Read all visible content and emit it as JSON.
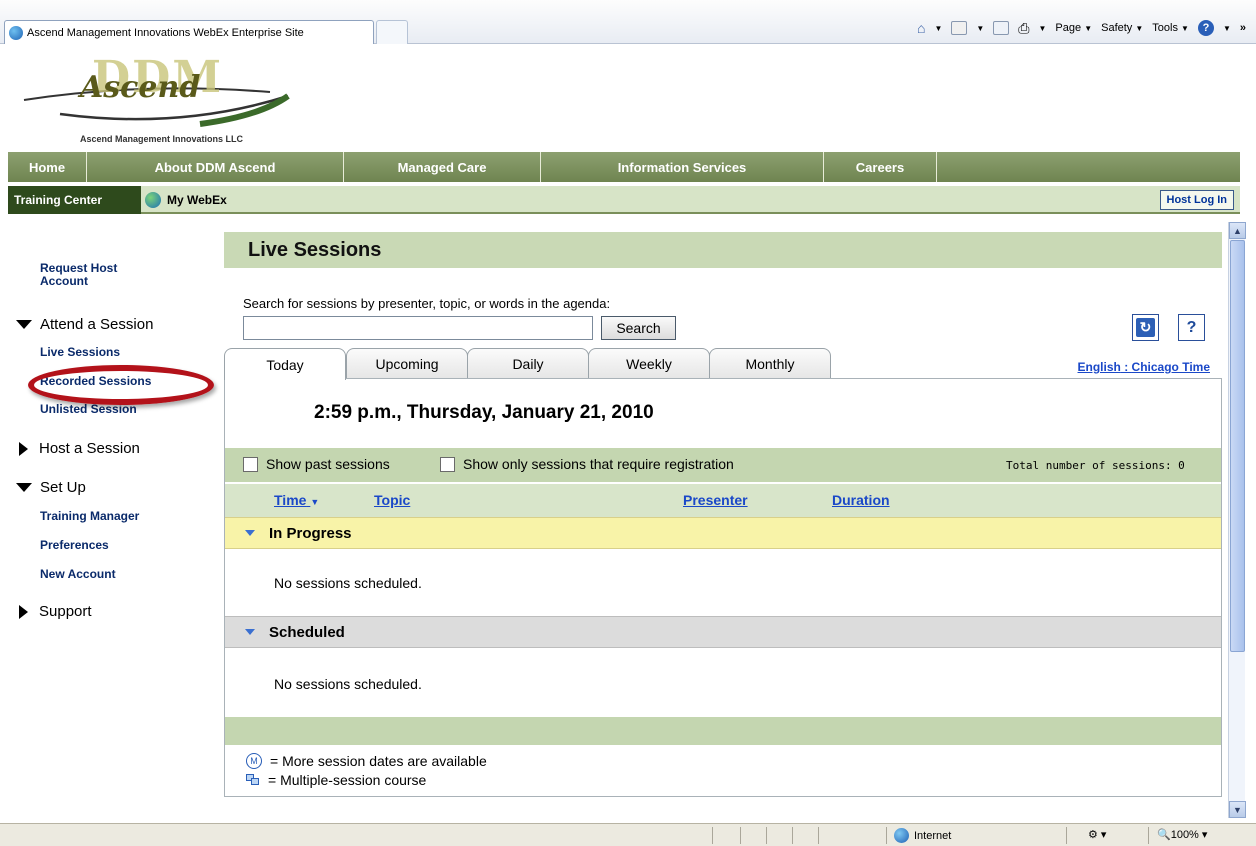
{
  "browser": {
    "tab_title": "Ascend Management Innovations WebEx Enterprise Site",
    "commands": [
      "Page",
      "Safety",
      "Tools"
    ],
    "status_zone": "Internet",
    "zoom": "100%"
  },
  "logo": {
    "mark": "DDM",
    "name": "Ascend",
    "company": "Ascend Management Innovations LLC"
  },
  "main_nav": [
    "Home",
    "About DDM Ascend",
    "Managed Care",
    "Information Services",
    "Careers"
  ],
  "sub_nav": {
    "training_center": "Training Center",
    "my_webex": "My WebEx",
    "host_login": "Host Log In"
  },
  "sidebar": {
    "request_host": "Request Host Account",
    "attend": {
      "label": "Attend a Session",
      "items": [
        "Live Sessions",
        "Recorded Sessions",
        "Unlisted Session"
      ]
    },
    "host": "Host a Session",
    "setup": {
      "label": "Set Up",
      "items": [
        "Training Manager",
        "Preferences",
        "New Account"
      ]
    },
    "support": "Support"
  },
  "content": {
    "title": "Live Sessions",
    "search_label": "Search for sessions by presenter, topic, or words in the agenda:",
    "search_value": "",
    "search_button": "Search",
    "tabs": [
      "Today",
      "Upcoming",
      "Daily",
      "Weekly",
      "Monthly"
    ],
    "active_tab": "Today",
    "lang_english": "English",
    "lang_sep": " : ",
    "lang_time": "Chicago Time",
    "datetime": "2:59 p.m., Thursday, January 21, 2010",
    "show_past": "Show past sessions",
    "show_registration": "Show only sessions that require registration",
    "total_sessions": "Total number of sessions: 0",
    "columns": {
      "time": "Time",
      "topic": "Topic",
      "presenter": "Presenter",
      "duration": "Duration"
    },
    "groups": {
      "in_progress": "In Progress",
      "scheduled": "Scheduled"
    },
    "empty_message": "No sessions scheduled.",
    "legend": {
      "more_dates": "= More session dates are available",
      "multi_session": "= Multiple-session course"
    }
  },
  "colors": {
    "nav_green": "#6f8450",
    "title_green": "#c9d9b5",
    "in_progress_yellow": "#f8f3a8",
    "scheduled_gray": "#dcdcdc",
    "annotation_red": "#b3121a"
  }
}
